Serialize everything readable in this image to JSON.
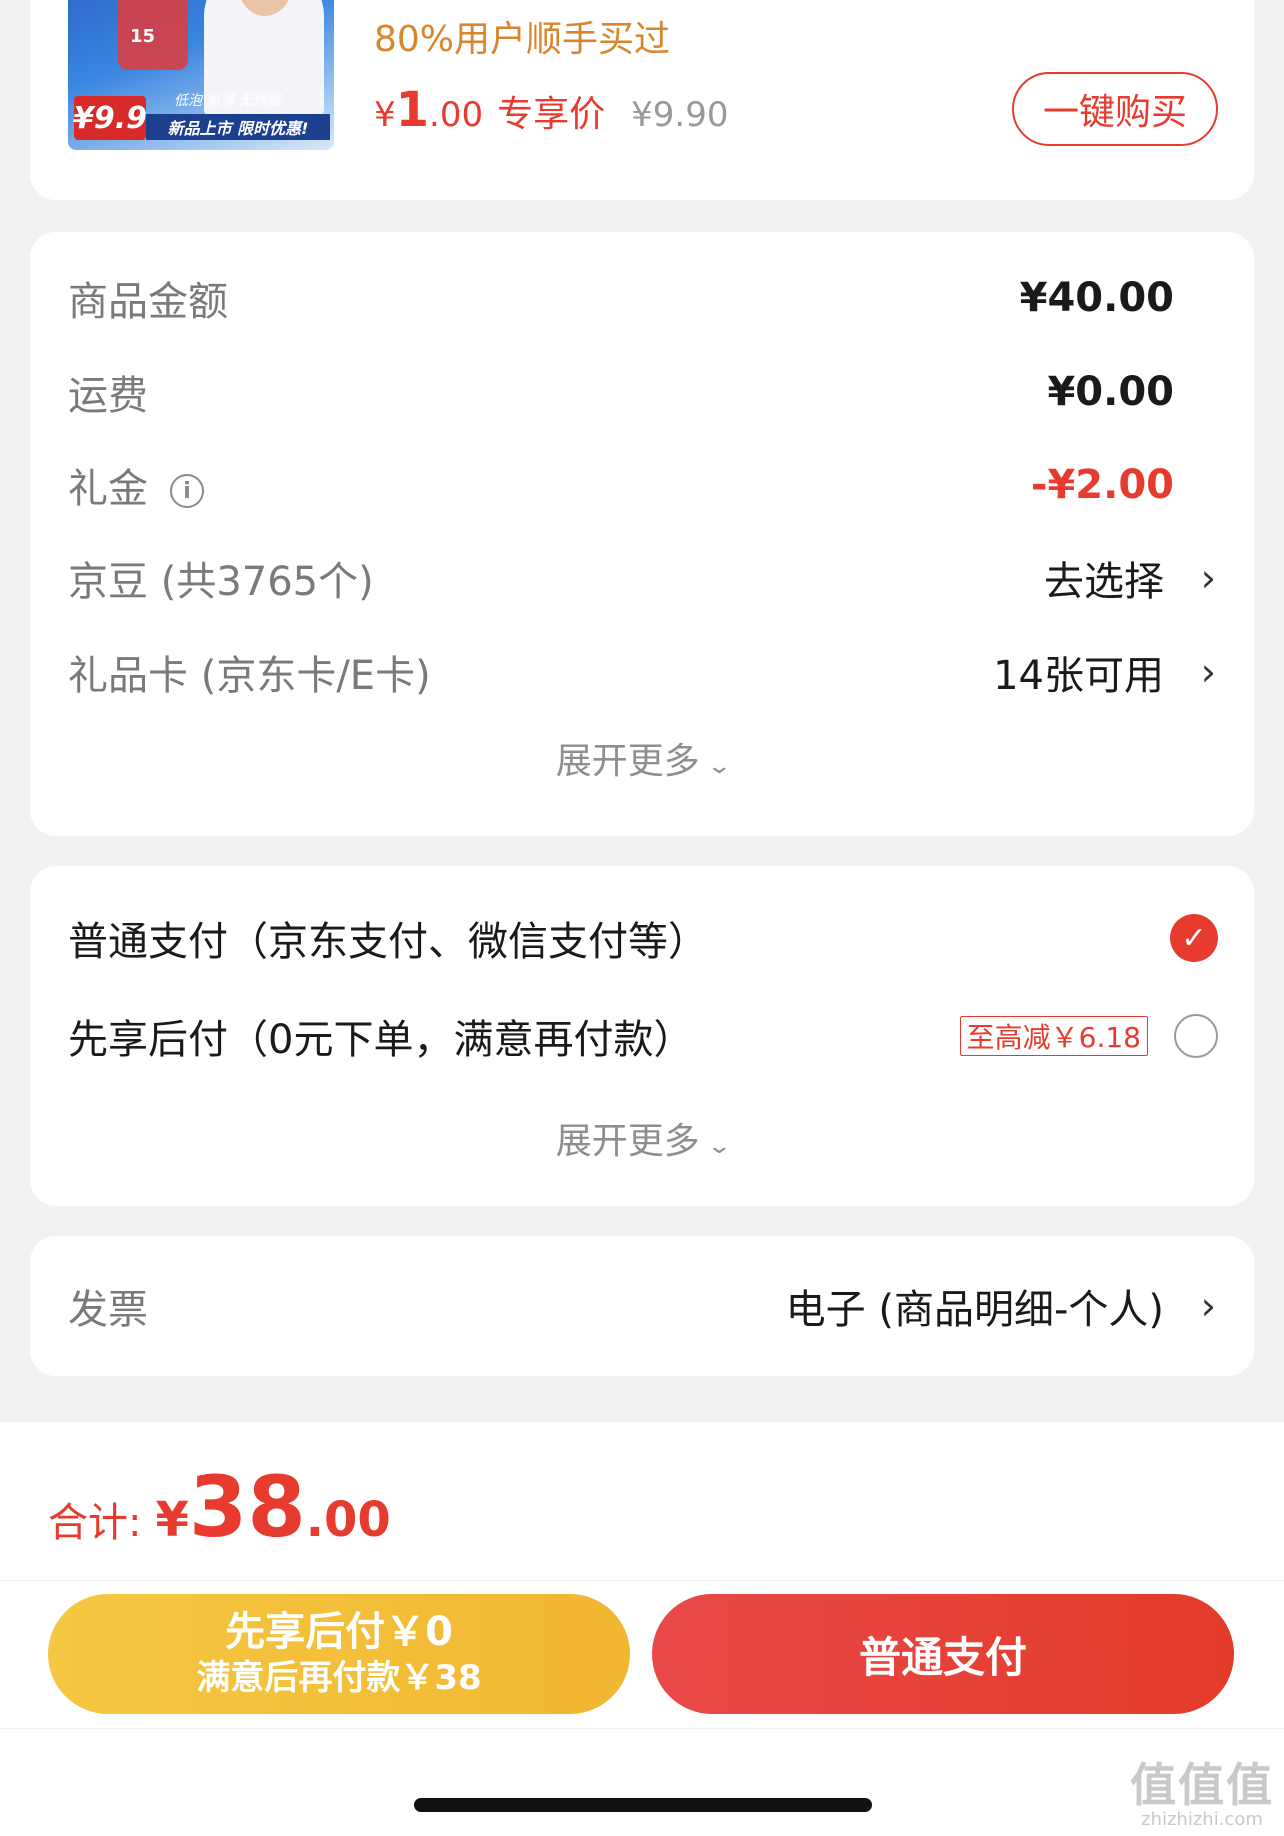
{
  "product": {
    "bought_text": "80%用户顺手买过",
    "price_symbol": "¥",
    "price_int": "1",
    "price_dec": ".00",
    "price_tag": "专享价",
    "original_price": "¥9.90",
    "one_click_label": "一键购买",
    "thumb": {
      "promo_price": "¥9.9",
      "promo_banner": "新品上市 限时优惠!",
      "promo_sub": "低泡 易漂 无残留",
      "bottle_num": "15"
    }
  },
  "summary": {
    "rows": [
      {
        "label": "商品金额",
        "value": "¥40.00"
      },
      {
        "label": "运费",
        "value": "¥0.00"
      },
      {
        "label": "礼金",
        "value": "-¥2.00",
        "info_icon": "i"
      },
      {
        "label": "京豆 (共3765个)",
        "value": "去选择"
      },
      {
        "label": "礼品卡 (京东卡/E卡)",
        "value": "14张可用"
      }
    ],
    "expand_label": "展开更多"
  },
  "payment": {
    "options": [
      {
        "label": "普通支付（京东支付、微信支付等）",
        "selected": true
      },
      {
        "label": "先享后付（0元下单，满意再付款）",
        "selected": false,
        "badge": "至高减￥6.18"
      }
    ],
    "expand_label": "展开更多"
  },
  "invoice": {
    "label": "发票",
    "value": "电子 (商品明细-个人)"
  },
  "bottom": {
    "total_label": "合计:",
    "total_yen": "¥",
    "total_int": "38",
    "total_dec": ".00",
    "later_line1": "先享后付￥0",
    "later_line2": "满意后再付款￥38",
    "pay_label": "普通支付"
  },
  "watermark": {
    "main": "值值值",
    "sub": "zhizhizhi.com"
  },
  "colors": {
    "accent": "#e63b2e",
    "gold": "#f2b631",
    "orange_text": "#d8862b"
  }
}
